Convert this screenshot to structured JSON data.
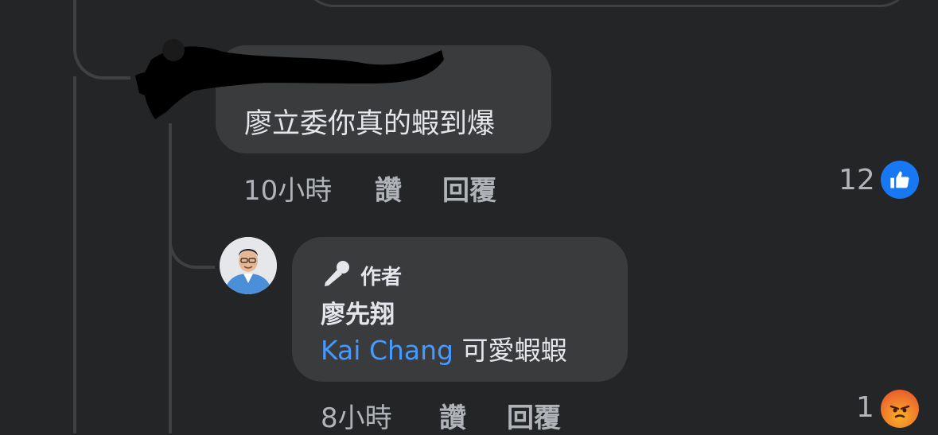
{
  "comment1": {
    "author_redacted": true,
    "text": "廖立委你真的蝦到爆",
    "time": "10小時",
    "like_label": "讚",
    "reply_label": "回覆",
    "reaction_count": "12",
    "reaction": "like-icon",
    "reaction_color": "#1877f2"
  },
  "comment2": {
    "author_badge": "作者",
    "author_badge_icon": "microphone-icon",
    "author_name": "廖先翔",
    "mention": "Kai Chang",
    "text": "可愛蝦蝦",
    "time": "8小時",
    "like_label": "讚",
    "reply_label": "回覆",
    "reaction_count": "1",
    "reaction": "angry-icon",
    "reaction_color": "#e9710f"
  },
  "colors": {
    "background": "#242526",
    "bubble": "#3a3b3c",
    "mention": "#4599ff",
    "meta_text": "#b0b3b8"
  }
}
